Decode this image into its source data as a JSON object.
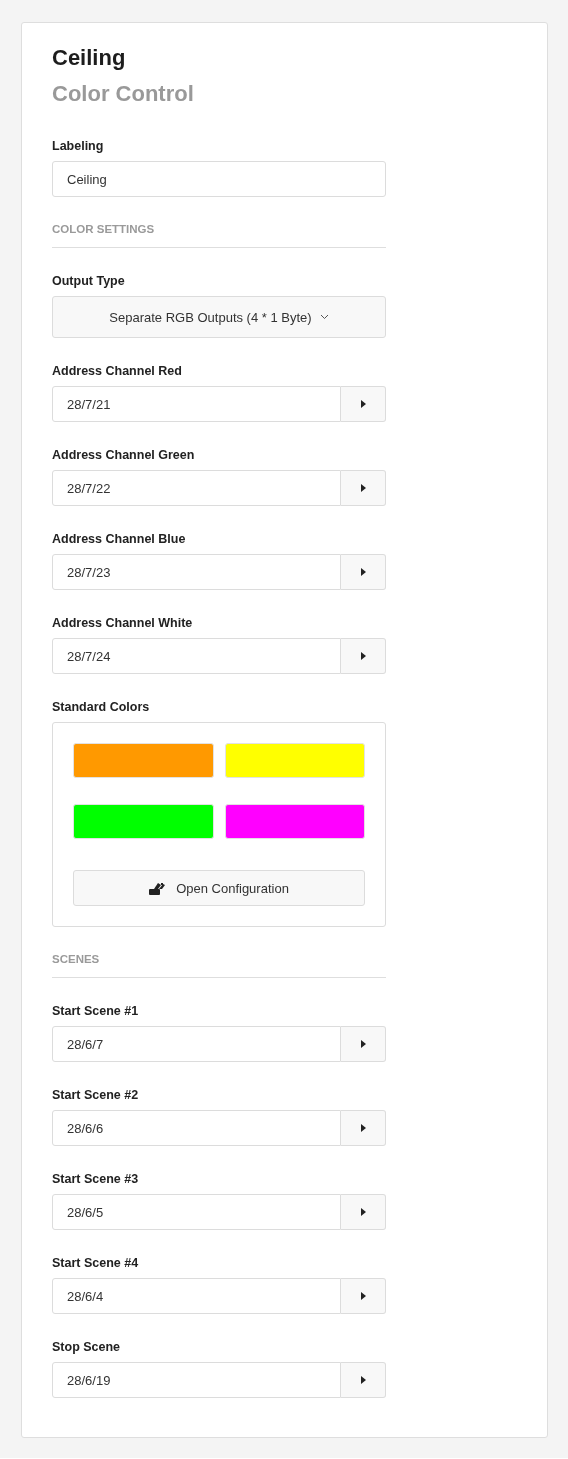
{
  "title": "Ceiling",
  "subtitle": "Color Control",
  "labeling": {
    "label": "Labeling",
    "value": "Ceiling"
  },
  "color_settings": {
    "heading": "COLOR SETTINGS",
    "output_type": {
      "label": "Output Type",
      "value": "Separate RGB Outputs (4 * 1 Byte)"
    },
    "addresses": [
      {
        "label": "Address Channel Red",
        "value": "28/7/21"
      },
      {
        "label": "Address Channel Green",
        "value": "28/7/22"
      },
      {
        "label": "Address Channel Blue",
        "value": "28/7/23"
      },
      {
        "label": "Address Channel White",
        "value": "28/7/24"
      }
    ],
    "standard_colors": {
      "label": "Standard Colors",
      "swatches": [
        {
          "color": "#ff9900"
        },
        {
          "color": "#ffff00"
        },
        {
          "color": "#00ff00"
        },
        {
          "color": "#ff00ff"
        }
      ],
      "button": "Open Configuration"
    }
  },
  "scenes": {
    "heading": "SCENES",
    "items": [
      {
        "label": "Start Scene #1",
        "value": "28/6/7"
      },
      {
        "label": "Start Scene #2",
        "value": "28/6/6"
      },
      {
        "label": "Start Scene #3",
        "value": "28/6/5"
      },
      {
        "label": "Start Scene #4",
        "value": "28/6/4"
      },
      {
        "label": "Stop Scene",
        "value": "28/6/19"
      }
    ]
  }
}
